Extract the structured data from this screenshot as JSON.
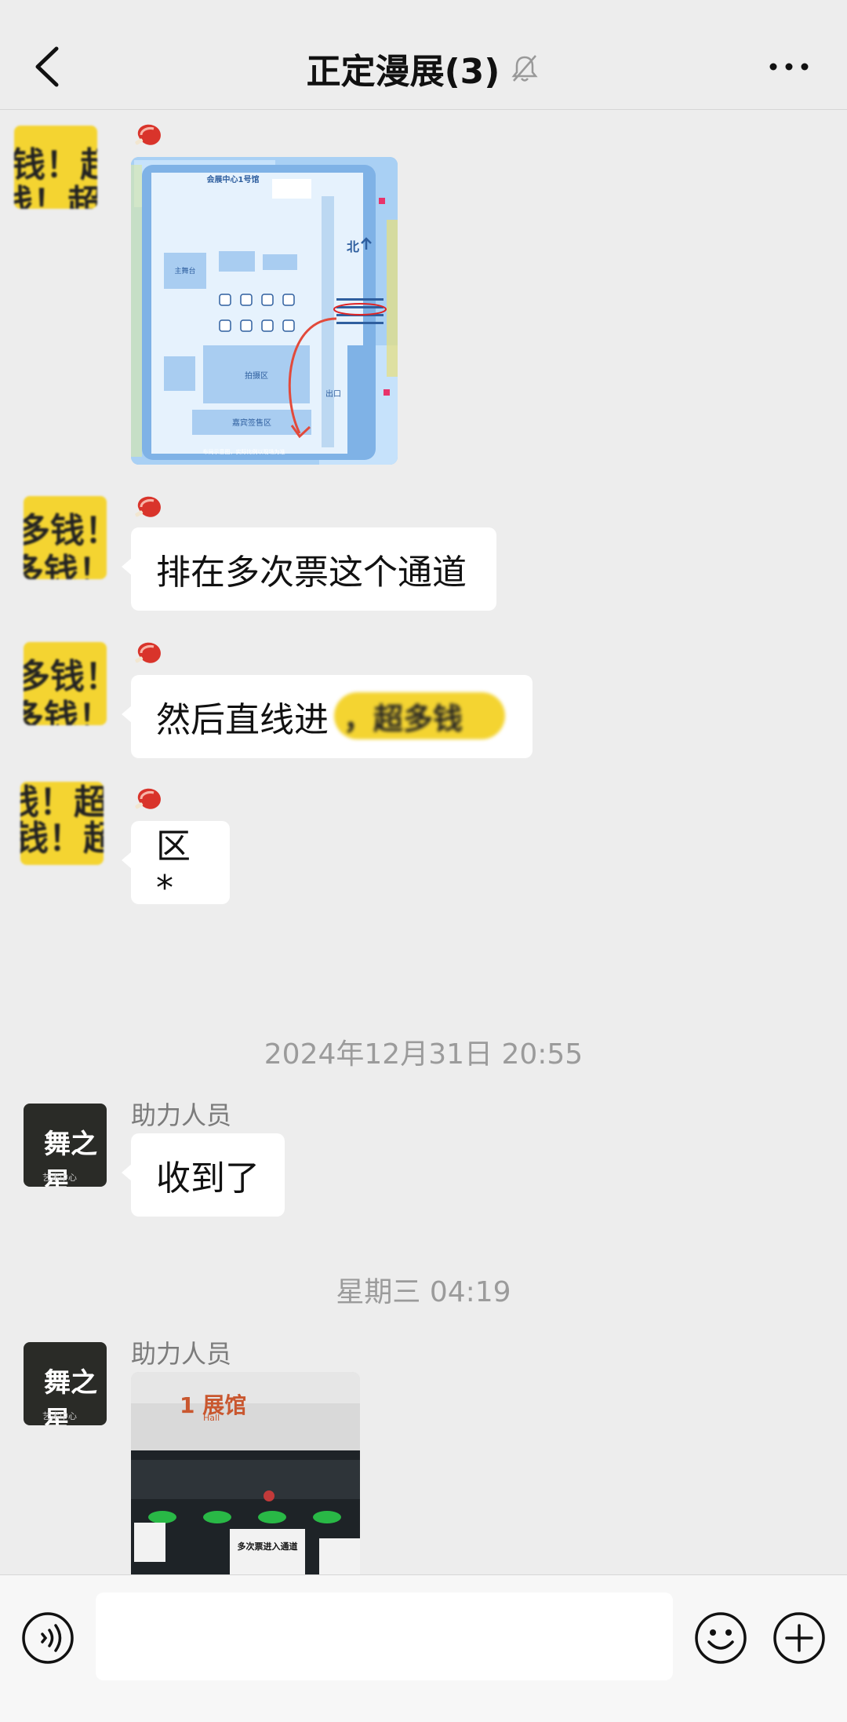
{
  "header": {
    "title": "正定漫展(3)",
    "back_icon": "chevron-left-icon",
    "mute_icon": "bell-slash-icon",
    "more_icon": "ellipsis-icon"
  },
  "messages": [
    {
      "type": "image",
      "content": "venue-map",
      "map_hall_title": "会展中心1号馆",
      "map_north": "北",
      "map_exit": "出口",
      "map_stage": "主舞台",
      "map_photo": "拍摄区",
      "map_vip": "嘉宾签售区",
      "map_note": "布局示意图，实际比例以现场为准"
    },
    {
      "type": "text",
      "text": "排在多次票这个通道"
    },
    {
      "type": "text",
      "text": "然后直线进"
    },
    {
      "type": "text",
      "text": "区*"
    }
  ],
  "avatar_blur_texts": [
    "钱！超多",
    "多钱！",
    "多钱！",
    "钱！超"
  ],
  "redaction_text": "，超多钱",
  "timestamp1": "2024年12月31日 20:55",
  "message_helper1": {
    "sender": "助力人员",
    "text": "收到了"
  },
  "timestamp2": "星期三 04:19",
  "message_helper2": {
    "sender": "助力人员",
    "image_texts": {
      "hall": "1 展馆",
      "hall_en": "Hall",
      "sign": "多次票进入通道"
    }
  },
  "helper_avatar": {
    "logo": "舞之星",
    "sub": "艺术中心"
  },
  "input_bar": {
    "voice_icon": "voice-icon",
    "emoji_icon": "emoji-icon",
    "plus_icon": "plus-circle-icon"
  }
}
